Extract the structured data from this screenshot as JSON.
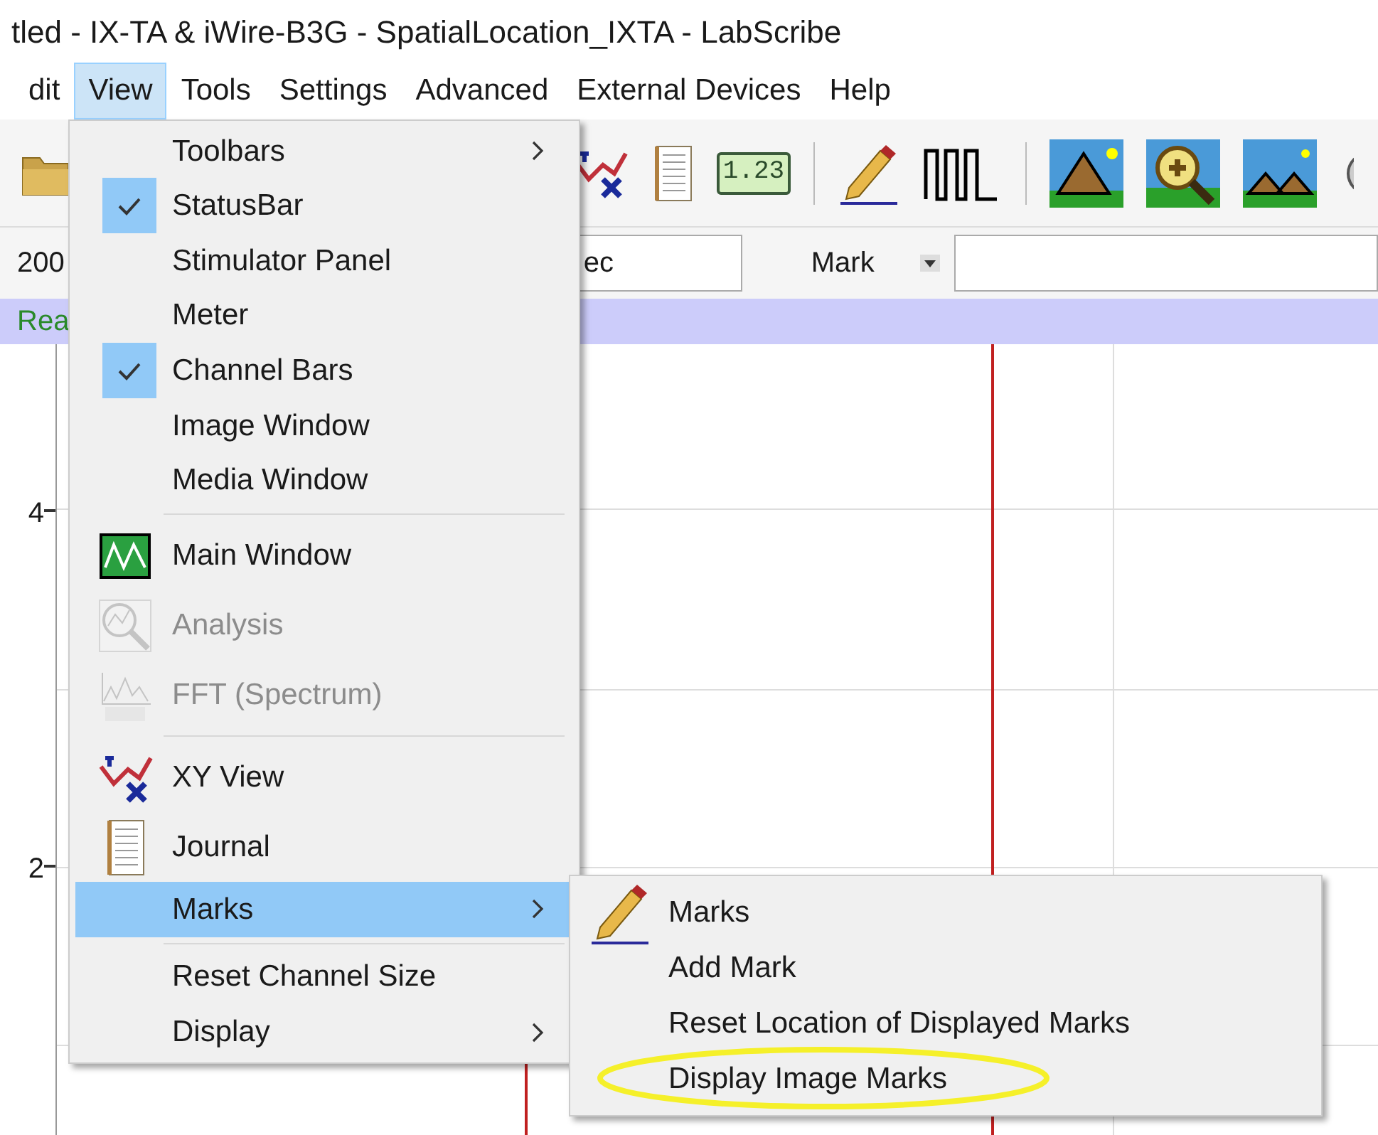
{
  "window": {
    "title": "tled - IX-TA & iWire-B3G - SpatialLocation_IXTA - LabScribe"
  },
  "menu_bar": [
    {
      "label": "dit",
      "selected": false
    },
    {
      "label": "View",
      "selected": true
    },
    {
      "label": "Tools",
      "selected": false
    },
    {
      "label": "Settings",
      "selected": false
    },
    {
      "label": "Advanced",
      "selected": false
    },
    {
      "label": "External Devices",
      "selected": false
    },
    {
      "label": "Help",
      "selected": false
    }
  ],
  "toolbar": {
    "counter_label": "1.23"
  },
  "controls": {
    "left_value": "200",
    "time_field": {
      "value": "ec"
    },
    "mark_label": "Mark"
  },
  "status_bar": {
    "text": "Rea"
  },
  "chart": {
    "y_labels": [
      "4",
      "2"
    ]
  },
  "view_menu": [
    {
      "kind": "item",
      "label": "Toolbars",
      "checked": false,
      "disabled": false,
      "selected": false,
      "submenu": true
    },
    {
      "kind": "item",
      "label": "StatusBar",
      "checked": true,
      "disabled": false,
      "selected": false,
      "submenu": false
    },
    {
      "kind": "item",
      "label": "Stimulator Panel",
      "checked": false,
      "disabled": false,
      "selected": false,
      "submenu": false
    },
    {
      "kind": "item",
      "label": "Meter",
      "checked": false,
      "disabled": false,
      "selected": false,
      "submenu": false
    },
    {
      "kind": "item",
      "label": "Channel Bars",
      "checked": true,
      "disabled": false,
      "selected": false,
      "submenu": false
    },
    {
      "kind": "item",
      "label": "Image Window",
      "checked": false,
      "disabled": false,
      "selected": false,
      "submenu": false
    },
    {
      "kind": "item",
      "label": "Media Window",
      "checked": false,
      "disabled": false,
      "selected": false,
      "submenu": false
    },
    {
      "kind": "separator"
    },
    {
      "kind": "item",
      "label": "Main Window",
      "checked": false,
      "disabled": false,
      "selected": false,
      "submenu": false
    },
    {
      "kind": "item",
      "label": "Analysis",
      "checked": false,
      "disabled": true,
      "selected": false,
      "submenu": false
    },
    {
      "kind": "item",
      "label": "FFT (Spectrum)",
      "checked": false,
      "disabled": true,
      "selected": false,
      "submenu": false
    },
    {
      "kind": "separator"
    },
    {
      "kind": "item",
      "label": "XY View",
      "checked": false,
      "disabled": false,
      "selected": false,
      "submenu": false
    },
    {
      "kind": "item",
      "label": "Journal",
      "checked": false,
      "disabled": false,
      "selected": false,
      "submenu": false
    },
    {
      "kind": "item",
      "label": "Marks",
      "checked": false,
      "disabled": false,
      "selected": true,
      "submenu": true
    },
    {
      "kind": "separator"
    },
    {
      "kind": "item",
      "label": "Reset Channel Size",
      "checked": false,
      "disabled": false,
      "selected": false,
      "submenu": false
    },
    {
      "kind": "item",
      "label": "Display",
      "checked": false,
      "disabled": false,
      "selected": false,
      "submenu": true
    }
  ],
  "marks_submenu": [
    {
      "label": "Marks",
      "highlighted": false
    },
    {
      "label": "Add Mark",
      "highlighted": false
    },
    {
      "label": "Reset Location of Displayed Marks",
      "highlighted": false
    },
    {
      "label": "Display Image Marks",
      "highlighted": true
    }
  ]
}
